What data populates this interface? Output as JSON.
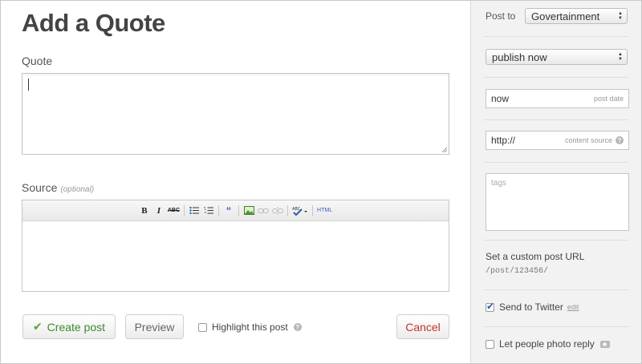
{
  "page": {
    "title": "Add a Quote",
    "quote_label": "Quote",
    "source_label": "Source",
    "source_optional": "(optional)"
  },
  "toolbar": {
    "bold": "B",
    "italic": "I",
    "strike": "ABC",
    "quote": "“",
    "html": "HTML"
  },
  "actions": {
    "create": "Create post",
    "preview": "Preview",
    "highlight": "Highlight this post",
    "cancel": "Cancel"
  },
  "sidebar": {
    "post_to_label": "Post to",
    "post_to_value": "Govertainment",
    "publish_value": "publish now",
    "date_value": "now",
    "date_hint": "post date",
    "source_value": "http://",
    "source_hint": "content source",
    "tags_placeholder": "tags",
    "custom_url_label": "Set a custom post URL",
    "custom_url_path": "/post/123456/",
    "send_twitter": "Send to Twitter",
    "send_twitter_checked": true,
    "edit_link": "edit",
    "photo_reply": "Let people photo reply",
    "photo_reply_checked": false
  },
  "colors": {
    "create_text": "#3f8a2e",
    "cancel_text": "#c4332b",
    "sidebar_bg": "#f2f2f2",
    "link_blue": "#3a63b8"
  }
}
